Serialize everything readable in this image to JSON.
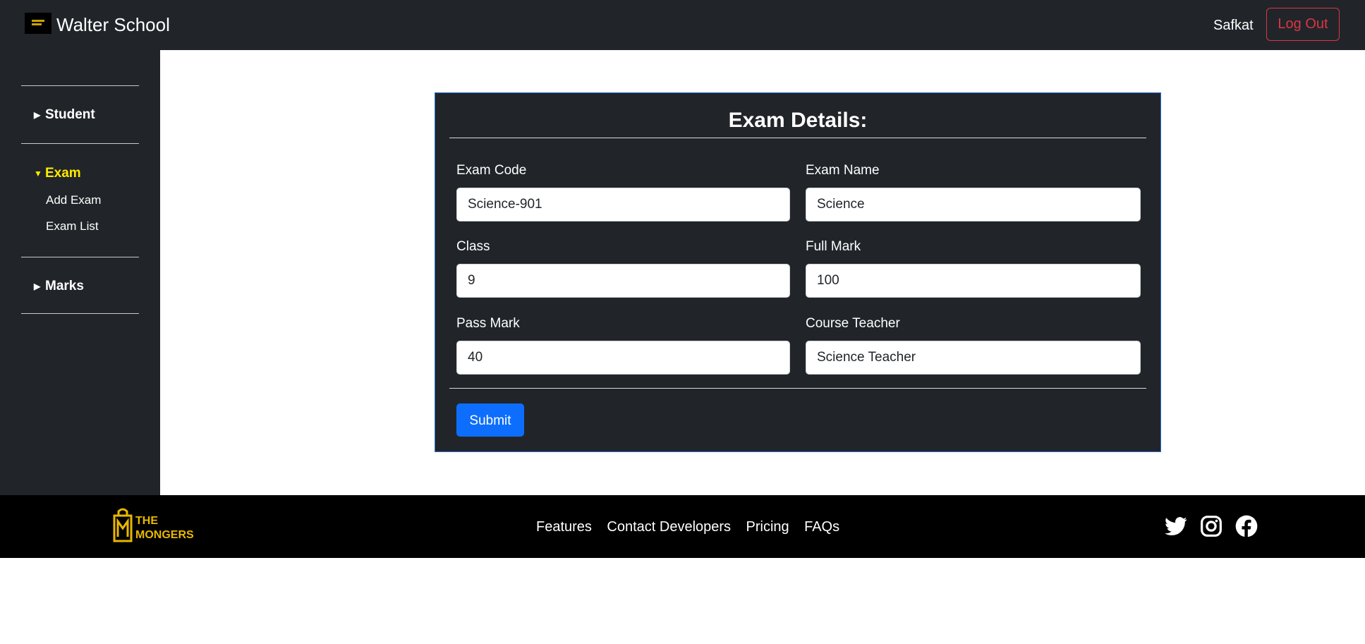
{
  "header": {
    "brand": "Walter School",
    "user": "Safkat",
    "logout_label": "Log Out"
  },
  "sidebar": {
    "items": [
      {
        "label": "Student",
        "expanded": false
      },
      {
        "label": "Exam",
        "expanded": true,
        "sub": [
          "Add Exam",
          "Exam List"
        ]
      },
      {
        "label": "Marks",
        "expanded": false
      }
    ]
  },
  "form": {
    "title": "Exam Details:",
    "fields": [
      {
        "label": "Exam Code",
        "value": "Science-901"
      },
      {
        "label": "Exam Name",
        "value": "Science"
      },
      {
        "label": "Class",
        "value": "9"
      },
      {
        "label": "Full Mark",
        "value": "100"
      },
      {
        "label": "Pass Mark",
        "value": "40"
      },
      {
        "label": "Course Teacher",
        "value": "Science Teacher"
      }
    ],
    "submit_label": "Submit"
  },
  "footer": {
    "logo_text": [
      "THE",
      "MONGERS"
    ],
    "links": [
      "Features",
      "Contact Developers",
      "Pricing",
      "FAQs"
    ],
    "social_icons": [
      "twitter-icon",
      "instagram-icon",
      "facebook-icon"
    ]
  },
  "colors": {
    "dark": "#212529",
    "accent_yellow": "#ffea00",
    "primary": "#0d6efd",
    "danger": "#dc3545"
  }
}
